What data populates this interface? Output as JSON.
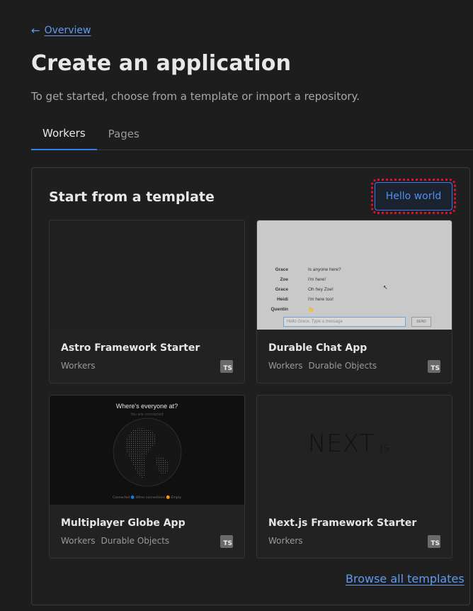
{
  "nav": {
    "back_label": "Overview"
  },
  "header": {
    "title": "Create an application",
    "subtitle": "To get started, choose from a template or import a repository."
  },
  "tabs": [
    {
      "label": "Workers",
      "active": true
    },
    {
      "label": "Pages",
      "active": false
    }
  ],
  "panel": {
    "title": "Start from a template",
    "hello_button": "Hello world",
    "browse_link": "Browse all templates"
  },
  "cards": [
    {
      "name": "Astro Framework Starter",
      "tags": [
        "Workers"
      ],
      "badge": "TS"
    },
    {
      "name": "Durable Chat App",
      "tags": [
        "Workers",
        "Durable Objects"
      ],
      "badge": "TS"
    },
    {
      "name": "Multiplayer Globe App",
      "tags": [
        "Workers",
        "Durable Objects"
      ],
      "badge": "TS"
    },
    {
      "name": "Next.js Framework Starter",
      "tags": [
        "Workers"
      ],
      "badge": "TS"
    }
  ],
  "chat_preview": {
    "messages": [
      {
        "name": "Grace",
        "text": "Is anyone here?"
      },
      {
        "name": "Zoe",
        "text": "I'm here!"
      },
      {
        "name": "Grace",
        "text": "Oh hey Zoe!"
      },
      {
        "name": "Heidi",
        "text": "I'm here too!"
      },
      {
        "name": "Quentin",
        "text": "👋"
      }
    ],
    "input_placeholder": "Hello Grace. Type a message",
    "send_label": "SEND"
  },
  "globe_preview": {
    "title": "Where's everyone at?",
    "subtitle": "You are connected",
    "legend": "Connected 🔵 Other connections 🟠 Empty"
  },
  "next_preview": {
    "logo": "NEXT",
    "logo_suffix": ".JS"
  },
  "colors": {
    "accent": "#2e80f0",
    "link": "#5f9bf0",
    "focus_ring": "#e0102c"
  }
}
